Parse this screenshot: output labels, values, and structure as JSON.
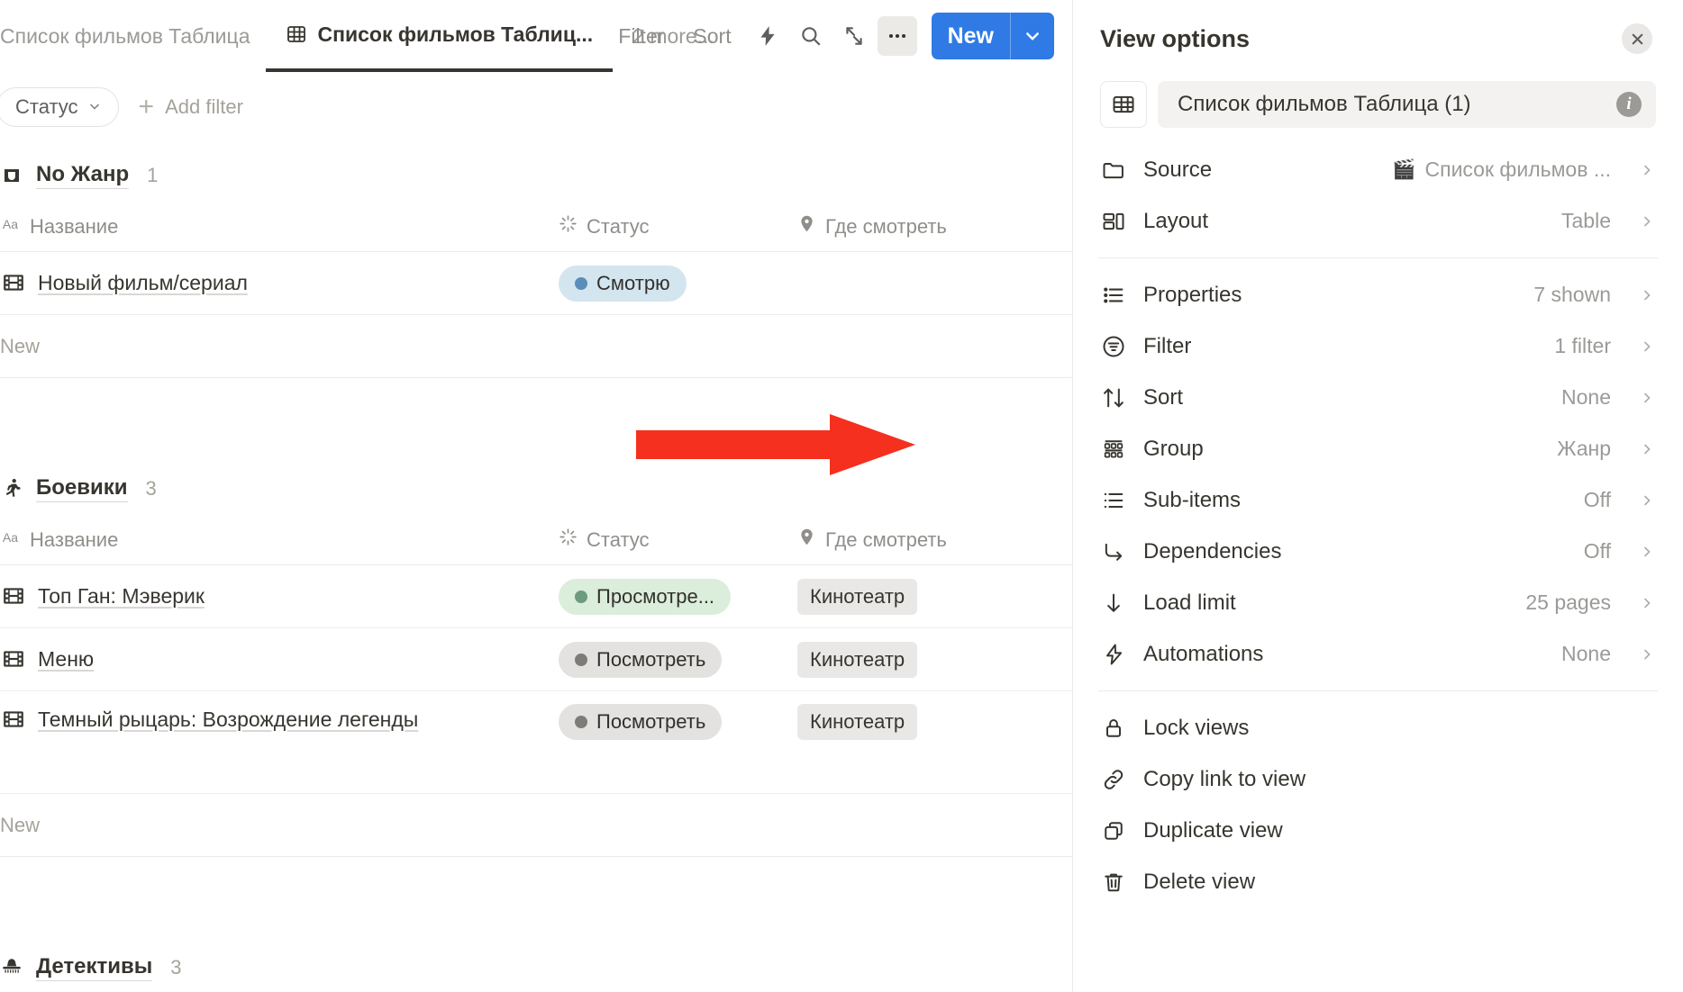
{
  "tabs": [
    {
      "label": "Список фильмов Таблица",
      "icon": "none",
      "active": false
    },
    {
      "label": "Список фильмов Таблиц...",
      "icon": "table-icon",
      "active": true
    },
    {
      "label": "2 more...",
      "icon": "none",
      "active": false
    }
  ],
  "toolbar": {
    "filter_label": "Filter",
    "sort_label": "Sort",
    "automation_icon": "lightning-icon",
    "search_icon": "search-icon",
    "expand_icon": "expand-icon",
    "more_icon": "ellipsis-icon",
    "new_label": "New",
    "new_caret_icon": "chevron-down-icon",
    "accent_color": "#2f7ae5"
  },
  "filter_bar": {
    "chip_label": "Статус",
    "chip_caret_icon": "chevron-down-icon",
    "add_filter_label": "Add filter"
  },
  "table": {
    "columns": [
      {
        "label": "Название",
        "icon": "aa-icon"
      },
      {
        "label": "Статус",
        "icon": "status-spinner-icon"
      },
      {
        "label": "Где смотреть",
        "icon": "location-pin-icon"
      }
    ],
    "new_row_label": "New",
    "groups": [
      {
        "emoji": "⬒",
        "name": "No Жанр",
        "count": "1",
        "rows": [
          {
            "title": "Новый фильм/сериал",
            "status": "Смотрю",
            "status_bg": "#d3e5ef",
            "status_dot": "#5b8db8",
            "where": ""
          }
        ]
      },
      {
        "emoji": "🏃",
        "name": "Боевики",
        "count": "3",
        "rows": [
          {
            "title": "Топ Ган: Мэверик",
            "status": "Просмотре...",
            "status_bg": "#dbeddb",
            "status_dot": "#6c9b7d",
            "where": "Кинотеатр"
          },
          {
            "title": "Меню",
            "status": "Посмотреть",
            "status_bg": "#e3e2e0",
            "status_dot": "#7d7c78",
            "where": "Кинотеатр"
          },
          {
            "title": "Темный рыцарь: Возрождение легенды",
            "status": "Посмотреть",
            "status_bg": "#e3e2e0",
            "status_dot": "#7d7c78",
            "where": "Кинотеатр"
          }
        ]
      },
      {
        "emoji": "🕵",
        "name": "Детективы",
        "count": "3",
        "rows": []
      }
    ]
  },
  "view_options": {
    "title": "View options",
    "close_icon": "close-icon",
    "view_icon": "table-icon",
    "view_name": "Список фильмов Таблица (1)",
    "info_icon": "info-icon",
    "sections": [
      {
        "items": [
          {
            "icon": "folder-icon",
            "label": "Source",
            "value": "Список фильмов ...",
            "value_emoji": "🎬",
            "chevron": true
          },
          {
            "icon": "layout-icon",
            "label": "Layout",
            "value": "Table",
            "chevron": true
          }
        ]
      },
      {
        "items": [
          {
            "icon": "properties-list-icon",
            "label": "Properties",
            "value": "7 shown",
            "chevron": true
          },
          {
            "icon": "filter-circle-icon",
            "label": "Filter",
            "value": "1 filter",
            "chevron": true
          },
          {
            "icon": "sort-arrows-icon",
            "label": "Sort",
            "value": "None",
            "chevron": true
          },
          {
            "icon": "group-grid-icon",
            "label": "Group",
            "value": "Жанр",
            "chevron": true
          },
          {
            "icon": "sub-items-icon",
            "label": "Sub-items",
            "value": "Off",
            "chevron": true
          },
          {
            "icon": "dependencies-arrow-icon",
            "label": "Dependencies",
            "value": "Off",
            "chevron": true
          },
          {
            "icon": "down-arrow-icon",
            "label": "Load limit",
            "value": "25 pages",
            "chevron": true
          },
          {
            "icon": "lightning-icon",
            "label": "Automations",
            "value": "None",
            "chevron": true
          }
        ]
      },
      {
        "items": [
          {
            "icon": "lock-icon",
            "label": "Lock views",
            "value": "",
            "chevron": false
          },
          {
            "icon": "link-icon",
            "label": "Copy link to view",
            "value": "",
            "chevron": false
          },
          {
            "icon": "duplicate-icon",
            "label": "Duplicate view",
            "value": "",
            "chevron": false
          },
          {
            "icon": "trash-icon",
            "label": "Delete view",
            "value": "",
            "chevron": false
          }
        ]
      }
    ]
  },
  "annotation": {
    "arrow_color": "#f5301e",
    "points_to": "Group"
  }
}
